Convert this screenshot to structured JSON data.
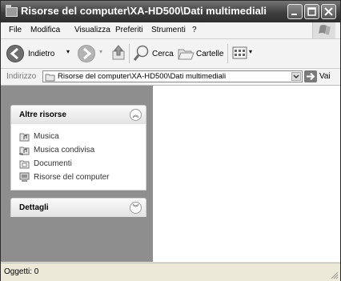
{
  "window": {
    "title": "Risorse del computer\\XA-HD500\\Dati multimediali"
  },
  "menu": [
    "File",
    "Modifica",
    "Visualizza",
    "Preferiti",
    "Strumenti",
    "?"
  ],
  "toolbar": {
    "back_label": "Indietro",
    "search_label": "Cerca",
    "folders_label": "Cartelle"
  },
  "address": {
    "label": "Indirizzo",
    "value": "Risorse del computer\\XA-HD500\\Dati multimediali",
    "go_label": "Vai"
  },
  "panels": {
    "other": {
      "title": "Altre risorse",
      "items": [
        {
          "label": "Musica",
          "icon": "music-folder-icon"
        },
        {
          "label": "Musica condivisa",
          "icon": "shared-music-folder-icon"
        },
        {
          "label": "Documenti",
          "icon": "documents-folder-icon"
        },
        {
          "label": "Risorse del computer",
          "icon": "my-computer-icon"
        }
      ]
    },
    "details": {
      "title": "Dettagli"
    }
  },
  "status": {
    "text": "Oggetti: 0"
  }
}
